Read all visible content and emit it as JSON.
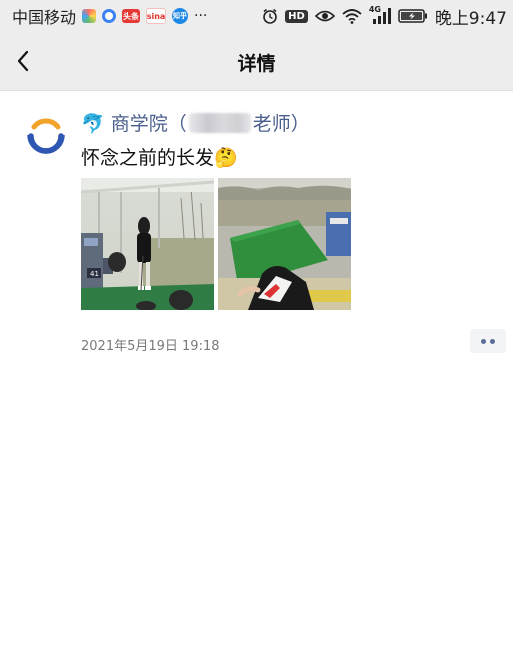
{
  "status_bar": {
    "carrier": "中国移动",
    "app_icons": [
      {
        "name": "app-icon-colorful",
        "label": "",
        "color": "#ff6f61"
      },
      {
        "name": "app-icon-ring",
        "label": "",
        "color": "#3b82f6"
      },
      {
        "name": "app-icon-toutiao",
        "label": "头条",
        "color": "#e53935"
      },
      {
        "name": "app-icon-sina",
        "label": "sina",
        "color": "#e0312b"
      },
      {
        "name": "app-icon-zhihu",
        "label": "知乎",
        "color": "#1e88e5"
      }
    ],
    "more_dots": "···",
    "hd_label": "HD",
    "network_label": "4G",
    "time": "晚上9:47"
  },
  "nav": {
    "title": "详情"
  },
  "post": {
    "author_prefix_icon": "dolphin-emoji",
    "author_left": "🐬 商学院（",
    "author_right": "老师）",
    "content": "怀念之前的长发🤔",
    "timestamp": "2021年5月19日 19:18",
    "photos": [
      {
        "name": "golf-driving-range-photo",
        "sign_label": "41"
      },
      {
        "name": "golf-mat-photo"
      }
    ]
  },
  "colors": {
    "nav_bg": "#ededed",
    "author_link": "#4a5f8c",
    "avatar_blue": "#2f56b3",
    "avatar_orange": "#f2a329",
    "more_dot": "#5a6d96"
  }
}
